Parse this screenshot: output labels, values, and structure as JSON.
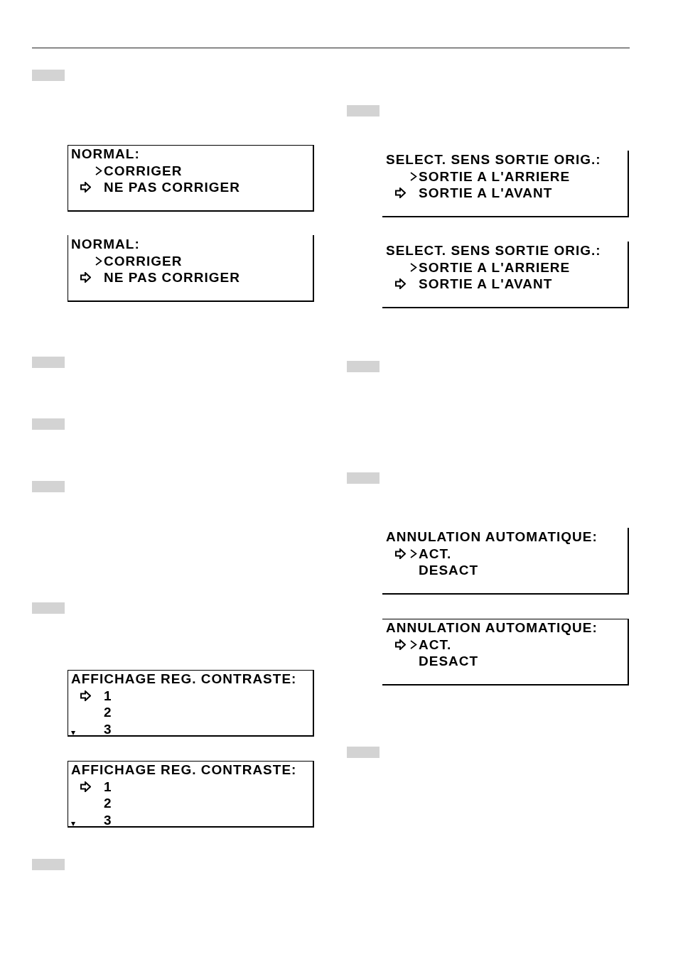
{
  "left_column": [
    {
      "kind": "marker"
    },
    {
      "kind": "display",
      "title": "NORMAL:",
      "frame": {
        "top": true,
        "right": true,
        "bottom": true,
        "left": true
      },
      "scroll_down": false,
      "lines": [
        {
          "text": "CORRIGER",
          "selected": false,
          "current": true
        },
        {
          "text": "NE PAS CORRIGER",
          "selected": true,
          "current": false
        }
      ]
    },
    {
      "kind": "display",
      "title": "NORMAL:",
      "frame": {
        "top": false,
        "right": true,
        "bottom": true,
        "left": true
      },
      "scroll_down": false,
      "lines": [
        {
          "text": "CORRIGER",
          "selected": false,
          "current": true
        },
        {
          "text": "NE PAS CORRIGER",
          "selected": true,
          "current": false
        }
      ]
    },
    {
      "kind": "marker"
    },
    {
      "kind": "marker"
    },
    {
      "kind": "marker"
    },
    {
      "kind": "marker"
    },
    {
      "kind": "display",
      "title": "AFFICHAGE REG. CONTRASTE:",
      "frame": {
        "top": true,
        "right": true,
        "bottom": true,
        "left": true
      },
      "scroll_down": true,
      "lines": [
        {
          "text": "1",
          "selected": true,
          "current": false
        },
        {
          "text": "2",
          "selected": false,
          "current": false
        },
        {
          "text": "3",
          "selected": false,
          "current": false
        }
      ]
    },
    {
      "kind": "display",
      "title": "AFFICHAGE REG. CONTRASTE:",
      "frame": {
        "top": true,
        "right": true,
        "bottom": true,
        "left": true
      },
      "scroll_down": true,
      "lines": [
        {
          "text": "1",
          "selected": true,
          "current": false
        },
        {
          "text": "2",
          "selected": false,
          "current": false
        },
        {
          "text": "3",
          "selected": false,
          "current": false
        }
      ]
    },
    {
      "kind": "marker"
    }
  ],
  "right_column": [
    {
      "kind": "marker"
    },
    {
      "kind": "display",
      "title": "SELECT. SENS SORTIE ORIG.:",
      "frame": {
        "top": false,
        "right": true,
        "bottom": true,
        "left": false
      },
      "scroll_down": false,
      "lines": [
        {
          "text": "SORTIE A L'ARRIERE",
          "selected": false,
          "current": true
        },
        {
          "text": "SORTIE A L'AVANT",
          "selected": true,
          "current": false
        }
      ]
    },
    {
      "kind": "display",
      "title": "SELECT. SENS SORTIE ORIG.:",
      "frame": {
        "top": false,
        "right": true,
        "bottom": true,
        "left": false
      },
      "scroll_down": false,
      "lines": [
        {
          "text": "SORTIE A L'ARRIERE",
          "selected": false,
          "current": true
        },
        {
          "text": "SORTIE A L'AVANT",
          "selected": true,
          "current": false
        }
      ]
    },
    {
      "kind": "marker"
    },
    {
      "kind": "marker"
    },
    {
      "kind": "display",
      "title": "ANNULATION AUTOMATIQUE:",
      "frame": {
        "top": false,
        "right": true,
        "bottom": true,
        "left": false
      },
      "scroll_down": false,
      "lines": [
        {
          "text": "ACT.",
          "selected": true,
          "current": true
        },
        {
          "text": "DESACT",
          "selected": false,
          "current": false
        }
      ]
    },
    {
      "kind": "display",
      "title": "ANNULATION AUTOMATIQUE:",
      "frame": {
        "top": true,
        "right": true,
        "bottom": true,
        "left": false
      },
      "scroll_down": false,
      "lines": [
        {
          "text": "ACT.",
          "selected": true,
          "current": true
        },
        {
          "text": "DESACT",
          "selected": false,
          "current": false
        }
      ]
    },
    {
      "kind": "marker"
    }
  ]
}
